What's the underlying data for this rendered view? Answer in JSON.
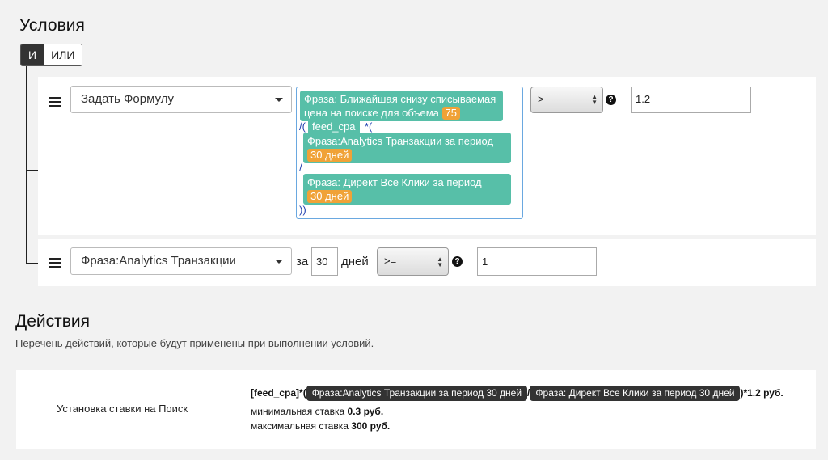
{
  "conditions": {
    "title": "Условия",
    "and_label": "И",
    "or_label": "ИЛИ",
    "row1": {
      "type_select": "Задать Формулу",
      "formula": {
        "chip1_text": "Фраза: Ближайшая снизу списываемая цена на поиске для объема",
        "chip1_badge": "75",
        "sym_div_open": "/(",
        "feed_chip": "feed_cpa",
        "sym_mul_open": "*(",
        "chip2_text": "Фраза:Analytics Транзакции за период",
        "chip2_badge": "30 дней",
        "sym_div": "/",
        "chip3_text": "Фраза: Директ Все Клики за период",
        "chip3_badge": "30 дней",
        "sym_close": "))"
      },
      "operator": ">",
      "help": "?",
      "value": "1.2"
    },
    "row2": {
      "type_select": "Фраза:Analytics Транзакции",
      "za_label": "за",
      "days_value": "30",
      "days_label": "дней",
      "operator": ">=",
      "help": "?",
      "value": "1"
    }
  },
  "actions": {
    "title": "Действия",
    "subtitle": "Перечень действий, которые будут применены при выполнении условий.",
    "item": {
      "name": "Установка ставки на Поиск",
      "formula_prefix": "[feed_cpa]*(",
      "chip1": "Фраза:Analytics Транзакции за период 30 дней",
      "divider": "/",
      "chip2": "Фраза: Директ Все Клики за период 30 дней",
      "formula_suffix": ")*1.2  руб.",
      "min_label": "минимальная ставка",
      "min_value": "0.3",
      "max_label": "максимальная ставка",
      "max_value": "300",
      "currency": "руб."
    }
  }
}
